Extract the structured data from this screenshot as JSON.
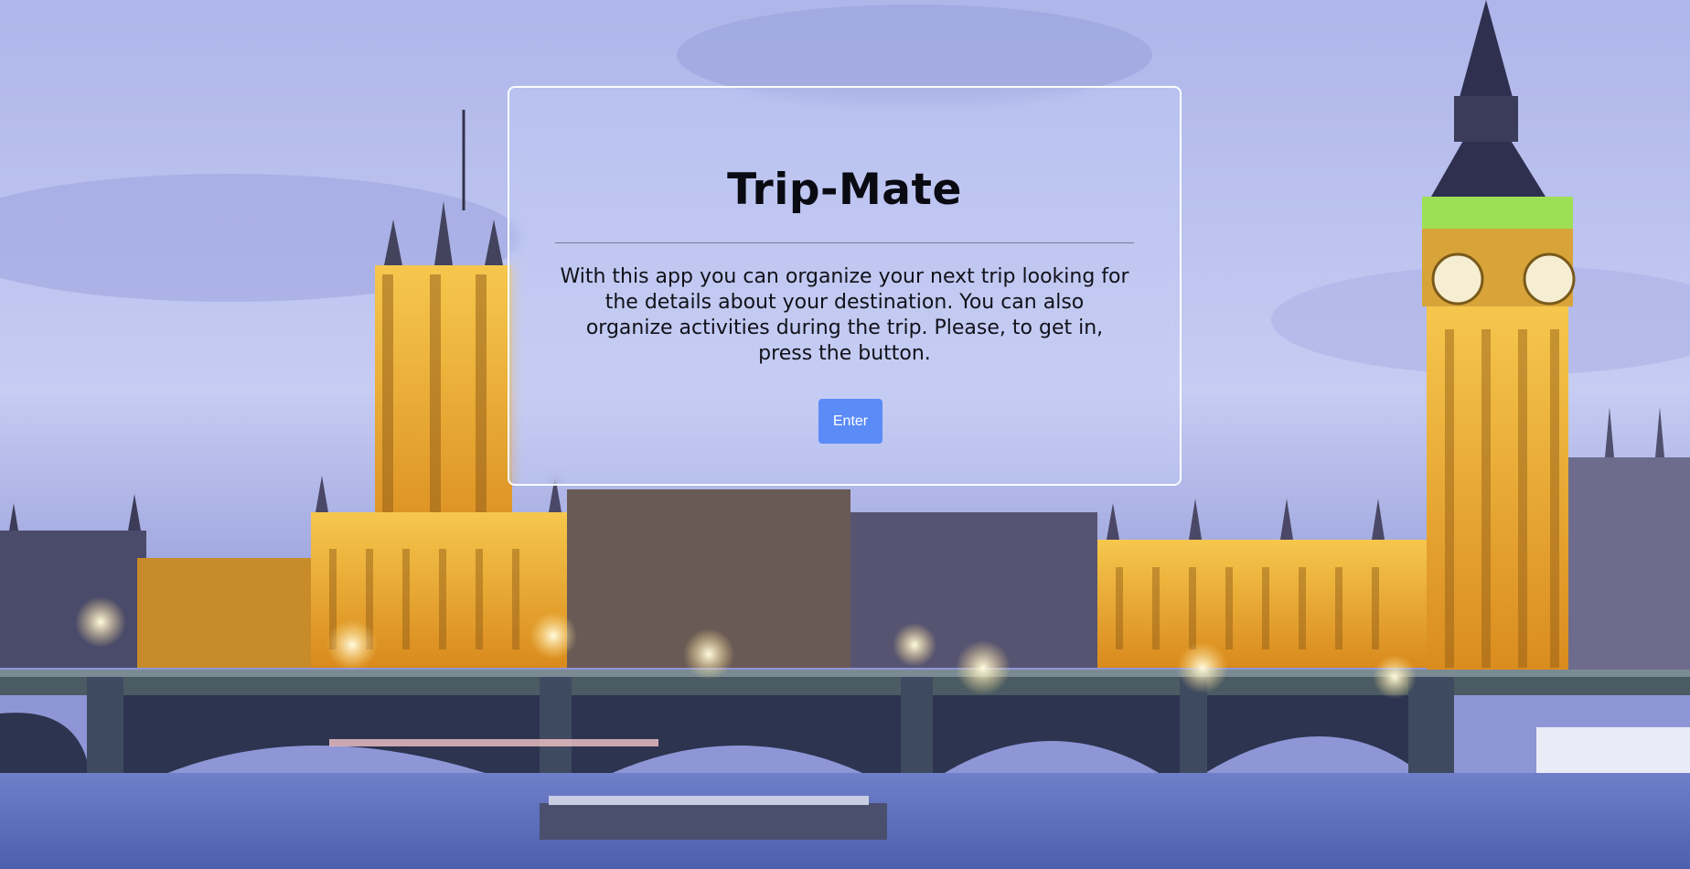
{
  "card": {
    "title": "Trip-Mate",
    "description": "With this app you can organize your next trip looking for the details about your destination. You can also organize activities during the trip. Please, to get in, press the button.",
    "enter_label": "Enter"
  },
  "colors": {
    "button": "#5b8bf7",
    "card_border": "#ffffff",
    "sky": "#b9c3ee",
    "river": "#6f7fc8",
    "lit_stone": "#f2b53a"
  },
  "icons": {
    "background": "london-skyline-background"
  }
}
